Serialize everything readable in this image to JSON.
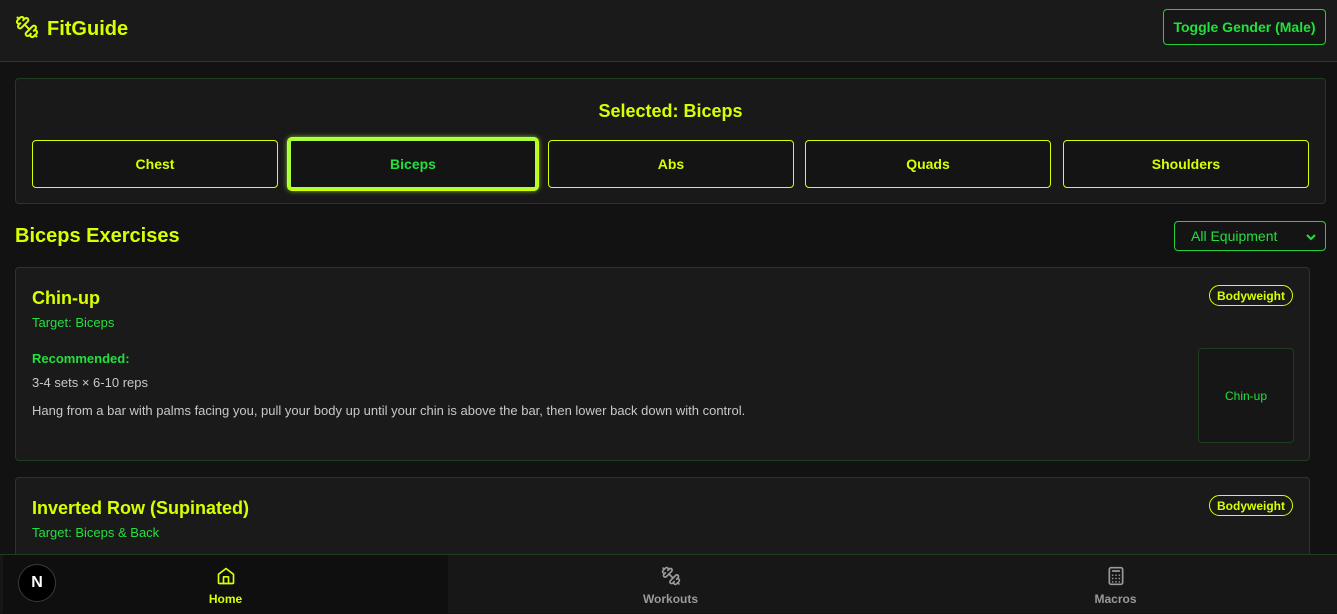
{
  "header": {
    "brand": "FitGuide",
    "toggle_label": "Toggle Gender (Male)"
  },
  "selector": {
    "selected_label": "Selected: Biceps",
    "muscles": [
      "Chest",
      "Biceps",
      "Abs",
      "Quads",
      "Shoulders"
    ],
    "active": "Biceps"
  },
  "section": {
    "title": "Biceps Exercises",
    "filter_value": "All Equipment"
  },
  "exercises": [
    {
      "name": "Chin-up",
      "target": "Target: Biceps",
      "badge": "Bodyweight",
      "recommended_label": "Recommended:",
      "recommended": "3-4 sets × 6-10 reps",
      "description": "Hang from a bar with palms facing you, pull your body up until your chin is above the bar, then lower back down with control.",
      "thumb_label": "Chin-up"
    },
    {
      "name": "Inverted Row (Supinated)",
      "target": "Target: Biceps & Back",
      "badge": "Bodyweight"
    }
  ],
  "nav": {
    "items": [
      {
        "label": "Home",
        "icon": "home-icon"
      },
      {
        "label": "Workouts",
        "icon": "dumbbell-icon"
      },
      {
        "label": "Macros",
        "icon": "calculator-icon"
      }
    ],
    "active": "Home"
  },
  "dev_badge": "N",
  "colors": {
    "accent_yellow": "#d9ff00",
    "accent_green": "#22e03e",
    "background": "#121212",
    "panel": "#1a1a1a",
    "border": "#1f3d1f"
  }
}
